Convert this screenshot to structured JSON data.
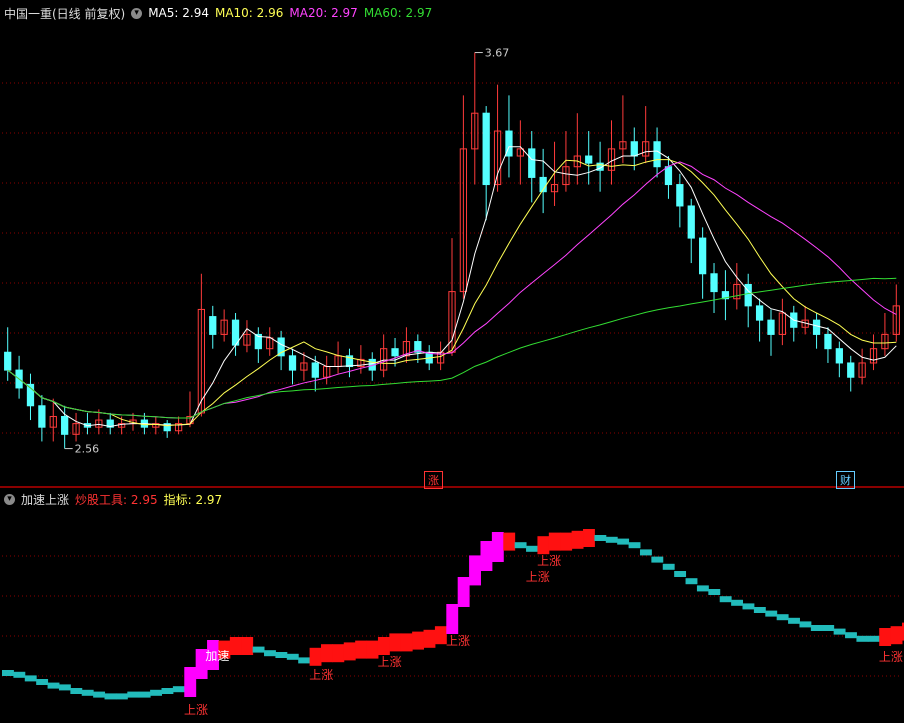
{
  "main_header": {
    "title": "中国一重(日线 前复权)",
    "ma5_label": "MA5: 2.94",
    "ma10_label": "MA10: 2.96",
    "ma20_label": "MA20: 2.97",
    "ma60_label": "MA60: 2.97"
  },
  "indicator_header": {
    "title": "加速上涨",
    "tool_label": "炒股工具: 2.95",
    "index_label": "指标: 2.97"
  },
  "annotations": {
    "high": "3.67",
    "low": "2.56",
    "badge_zhang": "涨",
    "badge_cai": "财",
    "jiasu": "加速",
    "shangzhang": "上涨"
  },
  "colors": {
    "up": "#ff3b3b",
    "down": "#54ffff",
    "ma5": "#ffffff",
    "ma10": "#ffff55",
    "ma20": "#ff44ff",
    "ma60": "#33dd33",
    "grid": "#8b0000",
    "accel": "#ff00ff",
    "rise": "#ff1111",
    "fall": "#22bbbb"
  },
  "chart_data": {
    "type": "candlestick",
    "price_range": [
      2.5,
      3.75
    ],
    "candles": [
      [
        2.83,
        2.78,
        2.9,
        2.75
      ],
      [
        2.78,
        2.73,
        2.82,
        2.7
      ],
      [
        2.74,
        2.68,
        2.77,
        2.64
      ],
      [
        2.68,
        2.62,
        2.71,
        2.58
      ],
      [
        2.62,
        2.65,
        2.7,
        2.58
      ],
      [
        2.65,
        2.6,
        2.68,
        2.56
      ],
      [
        2.6,
        2.63,
        2.66,
        2.58
      ],
      [
        2.63,
        2.62,
        2.66,
        2.6
      ],
      [
        2.62,
        2.64,
        2.67,
        2.6
      ],
      [
        2.64,
        2.62,
        2.66,
        2.6
      ],
      [
        2.62,
        2.63,
        2.65,
        2.6
      ],
      [
        2.63,
        2.64,
        2.66,
        2.61
      ],
      [
        2.64,
        2.62,
        2.66,
        2.6
      ],
      [
        2.62,
        2.63,
        2.65,
        2.6
      ],
      [
        2.63,
        2.61,
        2.64,
        2.59
      ],
      [
        2.61,
        2.63,
        2.65,
        2.6
      ],
      [
        2.63,
        2.65,
        2.72,
        2.62
      ],
      [
        2.66,
        2.95,
        3.05,
        2.65
      ],
      [
        2.93,
        2.88,
        2.96,
        2.84
      ],
      [
        2.88,
        2.92,
        2.95,
        2.86
      ],
      [
        2.92,
        2.85,
        2.94,
        2.82
      ],
      [
        2.85,
        2.88,
        2.92,
        2.83
      ],
      [
        2.88,
        2.84,
        2.9,
        2.8
      ],
      [
        2.84,
        2.87,
        2.9,
        2.82
      ],
      [
        2.87,
        2.82,
        2.89,
        2.78
      ],
      [
        2.82,
        2.78,
        2.84,
        2.74
      ],
      [
        2.78,
        2.8,
        2.83,
        2.75
      ],
      [
        2.8,
        2.76,
        2.82,
        2.72
      ],
      [
        2.76,
        2.79,
        2.82,
        2.74
      ],
      [
        2.79,
        2.82,
        2.86,
        2.77
      ],
      [
        2.82,
        2.79,
        2.84,
        2.76
      ],
      [
        2.79,
        2.81,
        2.85,
        2.77
      ],
      [
        2.81,
        2.78,
        2.83,
        2.75
      ],
      [
        2.78,
        2.84,
        2.88,
        2.76
      ],
      [
        2.84,
        2.82,
        2.87,
        2.79
      ],
      [
        2.82,
        2.86,
        2.9,
        2.8
      ],
      [
        2.86,
        2.83,
        2.88,
        2.8
      ],
      [
        2.83,
        2.8,
        2.85,
        2.78
      ],
      [
        2.8,
        2.83,
        2.86,
        2.78
      ],
      [
        2.83,
        3.0,
        3.15,
        2.82
      ],
      [
        3.0,
        3.4,
        3.55,
        2.98
      ],
      [
        3.4,
        3.5,
        3.67,
        3.3
      ],
      [
        3.5,
        3.3,
        3.52,
        3.2
      ],
      [
        3.3,
        3.45,
        3.58,
        3.28
      ],
      [
        3.45,
        3.38,
        3.55,
        3.32
      ],
      [
        3.38,
        3.4,
        3.48,
        3.3
      ],
      [
        3.4,
        3.32,
        3.45,
        3.25
      ],
      [
        3.32,
        3.28,
        3.4,
        3.22
      ],
      [
        3.28,
        3.3,
        3.42,
        3.24
      ],
      [
        3.3,
        3.35,
        3.45,
        3.28
      ],
      [
        3.35,
        3.38,
        3.5,
        3.3
      ],
      [
        3.38,
        3.36,
        3.45,
        3.3
      ],
      [
        3.36,
        3.34,
        3.42,
        3.28
      ],
      [
        3.34,
        3.4,
        3.48,
        3.3
      ],
      [
        3.4,
        3.42,
        3.55,
        3.36
      ],
      [
        3.42,
        3.38,
        3.46,
        3.34
      ],
      [
        3.38,
        3.42,
        3.52,
        3.36
      ],
      [
        3.42,
        3.35,
        3.46,
        3.32
      ],
      [
        3.35,
        3.3,
        3.38,
        3.26
      ],
      [
        3.3,
        3.24,
        3.33,
        3.18
      ],
      [
        3.24,
        3.15,
        3.26,
        3.08
      ],
      [
        3.15,
        3.05,
        3.18,
        2.98
      ],
      [
        3.05,
        3.0,
        3.08,
        2.94
      ],
      [
        3.0,
        2.98,
        3.06,
        2.92
      ],
      [
        2.98,
        3.02,
        3.08,
        2.95
      ],
      [
        3.02,
        2.96,
        3.05,
        2.9
      ],
      [
        2.96,
        2.92,
        2.98,
        2.86
      ],
      [
        2.92,
        2.88,
        2.95,
        2.82
      ],
      [
        2.88,
        2.94,
        2.98,
        2.85
      ],
      [
        2.94,
        2.9,
        2.96,
        2.86
      ],
      [
        2.9,
        2.92,
        2.96,
        2.88
      ],
      [
        2.92,
        2.88,
        2.94,
        2.84
      ],
      [
        2.88,
        2.84,
        2.9,
        2.8
      ],
      [
        2.84,
        2.8,
        2.86,
        2.76
      ],
      [
        2.8,
        2.76,
        2.82,
        2.72
      ],
      [
        2.76,
        2.8,
        2.84,
        2.74
      ],
      [
        2.8,
        2.84,
        2.88,
        2.78
      ],
      [
        2.84,
        2.88,
        2.94,
        2.82
      ],
      [
        2.88,
        2.96,
        3.02,
        2.86
      ]
    ],
    "indicator": {
      "range": [
        0,
        1
      ],
      "values": [
        0.15,
        0.14,
        0.12,
        0.1,
        0.08,
        0.07,
        0.05,
        0.04,
        0.03,
        0.02,
        0.02,
        0.03,
        0.03,
        0.04,
        0.05,
        0.06,
        0.1,
        0.2,
        0.25,
        0.28,
        0.3,
        0.3,
        0.28,
        0.26,
        0.25,
        0.24,
        0.22,
        0.24,
        0.26,
        0.26,
        0.27,
        0.28,
        0.28,
        0.3,
        0.32,
        0.32,
        0.33,
        0.34,
        0.36,
        0.45,
        0.6,
        0.72,
        0.8,
        0.85,
        0.88,
        0.86,
        0.84,
        0.86,
        0.88,
        0.88,
        0.89,
        0.9,
        0.9,
        0.89,
        0.88,
        0.86,
        0.82,
        0.78,
        0.74,
        0.7,
        0.66,
        0.62,
        0.6,
        0.56,
        0.54,
        0.52,
        0.5,
        0.48,
        0.46,
        0.44,
        0.42,
        0.4,
        0.4,
        0.38,
        0.36,
        0.34,
        0.34,
        0.35,
        0.36,
        0.38
      ],
      "state": [
        "f",
        "f",
        "f",
        "f",
        "f",
        "f",
        "f",
        "f",
        "f",
        "f",
        "f",
        "f",
        "f",
        "f",
        "f",
        "f",
        "a",
        "a",
        "a",
        "r",
        "r",
        "r",
        "f",
        "f",
        "f",
        "f",
        "f",
        "r",
        "r",
        "r",
        "r",
        "r",
        "r",
        "r",
        "r",
        "r",
        "r",
        "r",
        "r",
        "a",
        "a",
        "a",
        "a",
        "a",
        "r",
        "f",
        "f",
        "r",
        "r",
        "r",
        "r",
        "r",
        "f",
        "f",
        "f",
        "f",
        "f",
        "f",
        "f",
        "f",
        "f",
        "f",
        "f",
        "f",
        "f",
        "f",
        "f",
        "f",
        "f",
        "f",
        "f",
        "f",
        "f",
        "f",
        "f",
        "f",
        "f",
        "r",
        "r",
        "r"
      ]
    }
  }
}
